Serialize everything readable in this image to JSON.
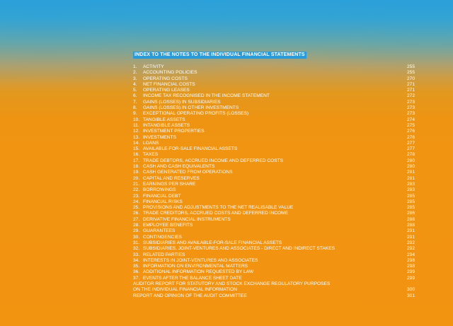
{
  "title": "INDEX TO THE NOTES TO THE INDIVIDUAL FINANCIAL STATEMENTS",
  "entries": [
    {
      "num": "1.",
      "label": "ACTIVITY",
      "page": "255"
    },
    {
      "num": "2.",
      "label": "ACCOUNTING POLICIES",
      "page": "255"
    },
    {
      "num": "3.",
      "label": "OPERATING COSTS",
      "page": "270"
    },
    {
      "num": "4.",
      "label": "NET FINANCIAL COSTS",
      "page": "271"
    },
    {
      "num": "5.",
      "label": "OPERATING LEASES",
      "page": "271"
    },
    {
      "num": "6.",
      "label": "INCOME TAX RECOGNISED IN THE INCOME STATEMENT",
      "page": "272"
    },
    {
      "num": "7.",
      "label": "GAINS (LOSSES) IN SUBSIDIARIES",
      "page": "273"
    },
    {
      "num": "8.",
      "label": "GAINS (LOSSES) IN OTHER INVESTMENTS",
      "page": "273"
    },
    {
      "num": "9.",
      "label": "EXCEPTIONAL OPERATING PROFITS (LOSSES)",
      "page": "273"
    },
    {
      "num": "10.",
      "label": "TANGIBLE ASSETS",
      "page": "274"
    },
    {
      "num": "11.",
      "label": "INTANGIBLE ASSETS",
      "page": "275"
    },
    {
      "num": "12.",
      "label": "INVESTMENT PROPERTIES",
      "page": "276"
    },
    {
      "num": "13.",
      "label": "INVESTMENTS",
      "page": "276"
    },
    {
      "num": "14.",
      "label": "LOANS",
      "page": "277"
    },
    {
      "num": "15.",
      "label": "AVAILABLE-FOR-SALE FINANCIAL ASSETS",
      "page": "277"
    },
    {
      "num": "16.",
      "label": "TAXES",
      "page": "278"
    },
    {
      "num": "17.",
      "label": "TRADE DEBTORS, ACCRUED INCOME AND DEFERRED COSTS",
      "page": "280"
    },
    {
      "num": "18.",
      "label": "CASH AND CASH EQUIVALENTS",
      "page": "280"
    },
    {
      "num": "19.",
      "label": "CASH GENERATED FROM OPERATIONS",
      "page": "281"
    },
    {
      "num": "20.",
      "label": "CAPITAL AND RESERVES",
      "page": "281"
    },
    {
      "num": "21.",
      "label": "EARNINGS PER SHARE",
      "page": "283"
    },
    {
      "num": "22.",
      "label": "BORROWINGS",
      "page": "283"
    },
    {
      "num": "23.",
      "label": "FINANCIAL DEBT",
      "page": "285"
    },
    {
      "num": "24.",
      "label": "FINANCIAL RISKS",
      "page": "285"
    },
    {
      "num": "25.",
      "label": "PROVISIONS AND ADJUSTMENTS TO THE NET REALISABLE VALUE",
      "page": "285"
    },
    {
      "num": "26.",
      "label": "TRADE CREDITORS, ACCRUED COSTS AND DEFERRED INCOME",
      "page": "286"
    },
    {
      "num": "27.",
      "label": "DERIVATIVE FINANCIAL INSTRUMENTS",
      "page": "286"
    },
    {
      "num": "28.",
      "label": "EMPLOYEE BENEFITS",
      "page": "288"
    },
    {
      "num": "29.",
      "label": "GUARANTEES",
      "page": "291"
    },
    {
      "num": "30.",
      "label": "CONTINGENCIES",
      "page": "291"
    },
    {
      "num": "31.",
      "label": "SUBSIDIARIES AND AVAILABLE-FOR-SALE FINANCIAL ASSETS",
      "page": "292"
    },
    {
      "num": "32.",
      "label": "SUBSIDIARIES, JOINT-VENTURES AND ASSOCIATES - DIRECT AND INDIRECT STAKES",
      "page": "292"
    },
    {
      "num": "33.",
      "label": "RELATED PARTIES",
      "page": "294"
    },
    {
      "num": "34.",
      "label": "INTERESTS IN JOINT-VENTURES AND ASSOCIATES",
      "page": "298"
    },
    {
      "num": "35.",
      "label": "INFORMATION ON ENVIRONMENTAL MATTERS",
      "page": "298"
    },
    {
      "num": "36.",
      "label": "ADDITIONAL INFORMATION REQUESTED BY LAW",
      "page": "299"
    },
    {
      "num": "37.",
      "label": "EVENTS AFTER THE BALANCE SHEET DATE",
      "page": "299"
    },
    {
      "num": "",
      "label": "AUDITOR REPORT FOR STATUTORY AND STOCK EXCHANGE REGULATORY PURPOSES",
      "page": ""
    },
    {
      "num": "",
      "label": "ON THE INDIVIDUAL FINANCIAL INFORMATION",
      "page": "300"
    },
    {
      "num": "",
      "label": "REPORT AND OPINION OF THE AUDIT COMMITTEE",
      "page": "301"
    }
  ]
}
